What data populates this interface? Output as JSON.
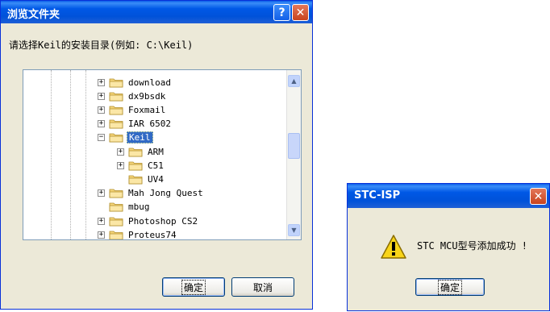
{
  "browse_dialog": {
    "title": "浏览文件夹",
    "help_glyph": "?",
    "close_glyph": "✕",
    "prompt": "请选择Keil的安装目录(例如: C:\\Keil)",
    "tree_items": [
      {
        "label": "download",
        "expander": "+"
      },
      {
        "label": "dx9bsdk",
        "expander": "+"
      },
      {
        "label": "Foxmail",
        "expander": "+"
      },
      {
        "label": "IAR 6502",
        "expander": "+"
      },
      {
        "label": "Keil",
        "expander": "−",
        "selected": true
      },
      {
        "label": "ARM",
        "expander": "+"
      },
      {
        "label": "C51",
        "expander": "+"
      },
      {
        "label": "UV4",
        "expander": ""
      },
      {
        "label": "Mah Jong Quest",
        "expander": "+"
      },
      {
        "label": "mbug",
        "expander": ""
      },
      {
        "label": "Photoshop CS2",
        "expander": "+"
      },
      {
        "label": "Proteus74",
        "expander": "+"
      }
    ],
    "ok_label": "确定",
    "cancel_label": "取消",
    "scroll_up_glyph": "▲",
    "scroll_down_glyph": "▼"
  },
  "message_box": {
    "title": "STC-ISP",
    "close_glyph": "✕",
    "message": "STC MCU型号添加成功 !",
    "ok_label": "确定"
  },
  "colors": {
    "titlebar_blue": "#0058e6",
    "window_face": "#ece9d8",
    "selection": "#316ac5",
    "close_red": "#c8431e",
    "folder_yellow": "#f6d67a"
  },
  "icons": {
    "folder": "folder-icon",
    "warning": "warning-icon"
  }
}
